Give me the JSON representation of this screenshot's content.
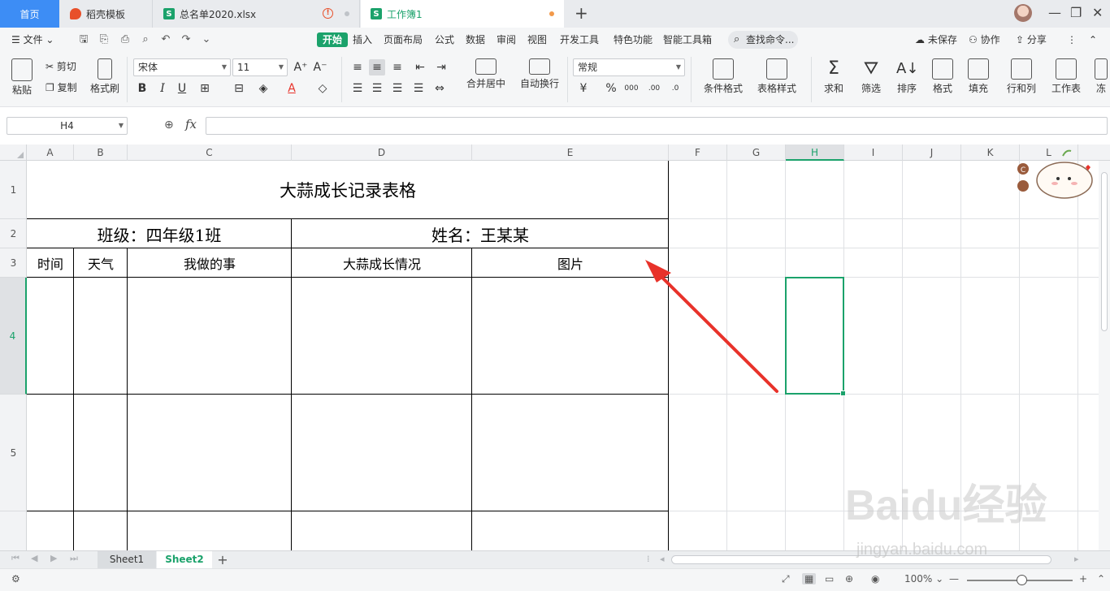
{
  "tabs": {
    "home": "首页",
    "daoke": "稻壳模板",
    "zongmingdan": "总名单2020.xlsx",
    "workbook": "工作簿1",
    "daoke_icon": "daoke-logo-icon",
    "sheet_icon_letter": "S"
  },
  "menu": {
    "file": "文件",
    "items": [
      "开始",
      "插入",
      "页面布局",
      "公式",
      "数据",
      "审阅",
      "视图",
      "开发工具",
      "特色功能",
      "智能工具箱"
    ],
    "search": "查找命令...",
    "unsaved": "未保存",
    "collab": "协作",
    "share": "分享"
  },
  "ribbon": {
    "paste": "粘贴",
    "cut": "剪切",
    "copy": "复制",
    "format_painter": "格式刷",
    "font_name": "宋体",
    "font_size": "11",
    "merge_center": "合并居中",
    "auto_wrap": "自动换行",
    "number_format": "常规",
    "cond_format": "条件格式",
    "table_style": "表格样式",
    "sum": "求和",
    "filter": "筛选",
    "sort": "排序",
    "format": "格式",
    "fill": "填充",
    "row_col": "行和列",
    "worksheet": "工作表",
    "more": "冻"
  },
  "formula_bar": {
    "cell_ref": "H4",
    "fx": "fx",
    "formula": ""
  },
  "columns": [
    "A",
    "B",
    "C",
    "D",
    "E",
    "F",
    "G",
    "H",
    "I",
    "J",
    "K",
    "L"
  ],
  "rows": [
    "1",
    "2",
    "3",
    "4",
    "5"
  ],
  "active": {
    "column": "H",
    "row": "4"
  },
  "table": {
    "title": "大蒜成长记录表格",
    "class_label": "班级：四年级1班",
    "name_label": "姓名：王某某",
    "headers": [
      "时间",
      "天气",
      "我做的事",
      "大蒜成长情况",
      "图片"
    ]
  },
  "sheets": {
    "sheet1": "Sheet1",
    "sheet2": "Sheet2",
    "active": "Sheet2"
  },
  "status": {
    "zoom": "100%"
  },
  "watermark": {
    "brand": "Baidu经验",
    "url": "jingyan.baidu.com"
  },
  "colors": {
    "accent": "#1ba26b",
    "home_tab": "#3d8df5",
    "arrow": "#e8322a"
  }
}
